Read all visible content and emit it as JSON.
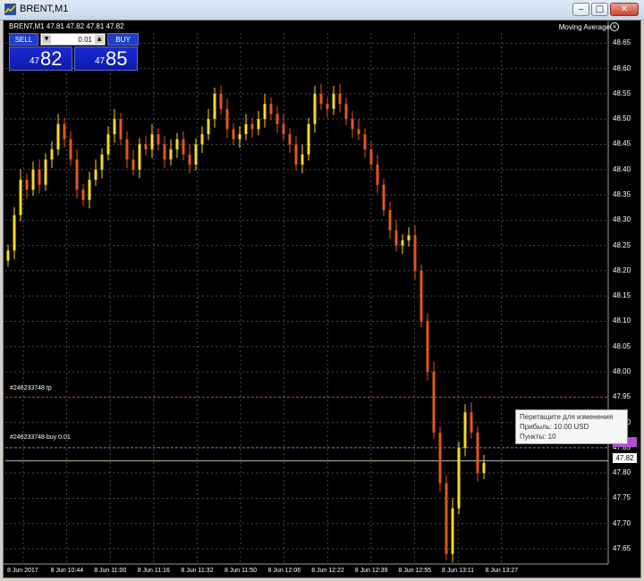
{
  "window": {
    "title": "BRENT,M1",
    "buttons": {
      "minimize": "‒",
      "maximize": "□",
      "close": "✕"
    }
  },
  "chart": {
    "symbol_info": "BRENT,M1  47.81 47.82 47.81 47.82",
    "indicator": "Moving Average"
  },
  "trade_panel": {
    "sell_label": "SELL",
    "buy_label": "BUY",
    "lot": "0.01",
    "sell_small": "47",
    "sell_big": "82",
    "buy_small": "47",
    "buy_big": "85"
  },
  "order_lines": {
    "tp_label": "#246233748 tp",
    "buy_label": "#246233748 buy 0.01"
  },
  "tooltip": {
    "line1": "Перетащите для изменения",
    "line2": "Прибыль: 10.00 USD",
    "line3": "Пункты: 10"
  },
  "current_price": "47.82",
  "price_axis": [
    "48.65",
    "48.60",
    "48.55",
    "48.50",
    "48.45",
    "48.40",
    "48.35",
    "48.30",
    "48.25",
    "48.20",
    "48.15",
    "48.10",
    "48.05",
    "48.00",
    "47.95",
    "47.90",
    "47.85",
    "47.80",
    "47.75",
    "47.70",
    "47.65"
  ],
  "time_axis": [
    "8 Jun 2017",
    "8 Jun 10:44",
    "8 Jun 11:00",
    "8 Jun 11:16",
    "8 Jun 11:32",
    "8 Jun 11:50",
    "8 Jun 12:06",
    "8 Jun 12:22",
    "8 Jun 12:39",
    "8 Jun 12:55",
    "8 Jun 13:11",
    "8 Jun 13:27"
  ],
  "chart_data": {
    "type": "candlestick",
    "y_range": [
      47.62,
      48.67
    ],
    "series": [
      {
        "close": [
          48.24,
          48.31,
          48.38,
          48.36,
          48.4,
          48.37,
          48.42,
          48.44,
          48.49,
          48.46,
          48.42,
          48.36,
          48.34,
          48.38,
          48.4,
          48.43,
          48.47,
          48.5,
          48.46,
          48.42,
          48.4,
          48.45,
          48.44,
          48.47,
          48.45,
          48.42,
          48.44,
          48.46,
          48.43,
          48.41,
          48.45,
          48.47,
          48.5,
          48.55,
          48.52,
          48.48,
          48.46,
          48.47,
          48.49,
          48.48,
          48.5,
          48.53,
          48.51,
          48.49,
          48.47,
          48.45,
          48.41,
          48.43,
          48.49,
          48.55,
          48.53,
          48.52,
          48.55,
          48.53,
          48.5,
          48.48,
          48.47,
          48.44,
          48.41,
          48.37,
          48.32,
          48.28,
          48.25,
          48.26,
          48.27,
          48.2,
          48.1,
          48.0,
          47.88,
          47.78,
          47.64,
          47.73,
          47.85,
          47.92,
          47.88,
          47.8,
          47.82
        ]
      }
    ]
  }
}
